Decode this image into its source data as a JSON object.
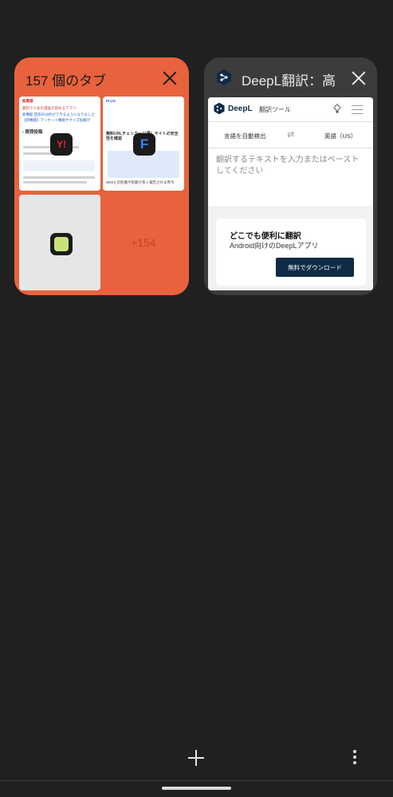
{
  "group": {
    "title": "157 個のタブ",
    "more_count": "+154",
    "thumb_1": {
      "site": "知恵袋",
      "heading": "‹ 質問投稿",
      "line_a": "無料で人気の漫画が読めるアプリ",
      "line_b": "新機能 回答の分析ができるようになりました",
      "line_c": "【新機能】アンケート機能やクイズ投稿が"
    },
    "thumb_2": {
      "site": "PLUX",
      "headline": "無料URLチェッカー11選！サイトの安全性を確認",
      "line_a": "Webとの危険や犯罪が多く報告される昨今"
    },
    "badges": {
      "yahoo": "Y!",
      "app2": "F"
    }
  },
  "tab": {
    "title": "DeepL翻訳：高",
    "favicon": "deepl-logo-icon"
  },
  "deepl": {
    "brand": "DeepL",
    "tool": "翻訳ツール",
    "source_lang": "言語を自動検出",
    "target_lang": "英語（US）",
    "placeholder": "翻訳するテキストを入力またはペーストしてください",
    "promo_title": "どこでも便利に翻訳",
    "promo_sub": "Android向けのDeepLアプリ",
    "promo_button": "無料でダウンロード"
  },
  "colors": {
    "background": "#202020",
    "group_card": "#e8633d",
    "tab_card": "#3c3c3c",
    "deepl_navy": "#0f2b46"
  },
  "icons": [
    "close-icon",
    "plus-icon",
    "more-vert-icon",
    "bulb-icon",
    "menu-icon",
    "swap-icon"
  ]
}
